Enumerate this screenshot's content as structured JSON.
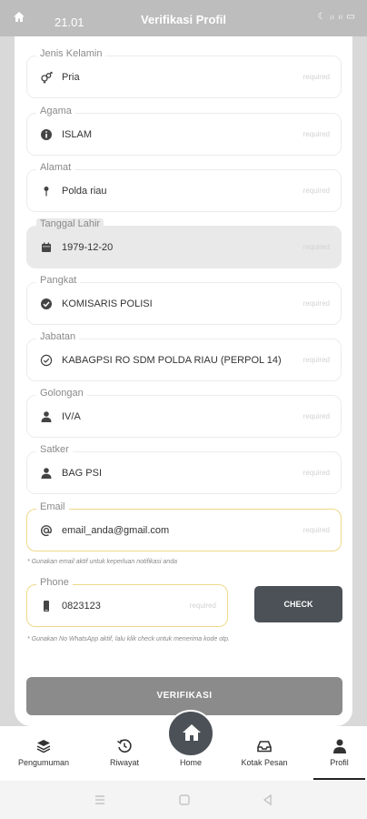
{
  "status_bar": {
    "time": "21.01",
    "title": "Verifikasi Profil",
    "system": "☾ ᵢₗ ₗₗ ▭"
  },
  "fields": [
    {
      "label": "Jenis Kelamin",
      "value": "Pria",
      "required": "required",
      "icon": "gender-icon"
    },
    {
      "label": "Agama",
      "value": "ISLAM",
      "required": "required",
      "icon": "info-icon"
    },
    {
      "label": "Alamat",
      "value": "Polda riau",
      "required": "required",
      "icon": "location-pin-icon"
    },
    {
      "label": "Tanggal Lahir",
      "value": "1979-12-20",
      "required": "required",
      "icon": "calendar-icon"
    },
    {
      "label": "Pangkat",
      "value": "KOMISARIS POLISI",
      "required": "required",
      "icon": "check-circle-icon"
    },
    {
      "label": "Jabatan",
      "value": "KABAGPSI RO SDM POLDA RIAU (PERPOL 14)",
      "required": "required",
      "icon": "check-outline-icon"
    },
    {
      "label": "Golongan",
      "value": "IV/A",
      "required": "required",
      "icon": "person-icon"
    },
    {
      "label": "Satker",
      "value": "BAG PSI",
      "required": "required",
      "icon": "person-icon"
    },
    {
      "label": "Email",
      "value": "email_anda@gmail.com",
      "required": "required",
      "icon": "at-icon"
    },
    {
      "label": "Phone",
      "value": "0823123",
      "required": "required",
      "icon": "phone-icon"
    }
  ],
  "hints": {
    "email": "* Gunakan email aktif untuk keperluan notifikasi anda",
    "phone": "* Gunakan No WhatsApp aktif, lalu klik check untuk menerima kode otp."
  },
  "buttons": {
    "check": "CHECK",
    "verify": "VERIFIKASI"
  },
  "nav": {
    "items": [
      {
        "label": "Pengumuman",
        "icon": "layers-icon"
      },
      {
        "label": "Riwayat",
        "icon": "history-icon"
      },
      {
        "label": "Home",
        "icon": "home-icon"
      },
      {
        "label": "Kotak Pesan",
        "icon": "inbox-icon"
      },
      {
        "label": "Profil",
        "icon": "profile-icon"
      }
    ],
    "active": "Profil"
  }
}
